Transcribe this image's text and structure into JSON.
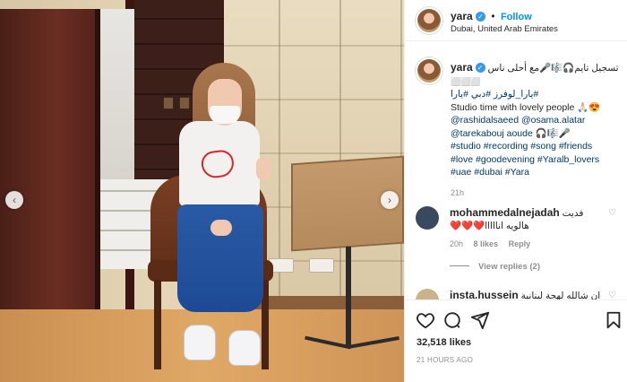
{
  "post": {
    "username": "yara",
    "follow_label": "Follow",
    "separator": "•",
    "location": "Dubai, United Arab Emirates",
    "verified_mark": "✓"
  },
  "caption": {
    "username": "yara",
    "line1": "تسجيل تايم🎧🎼🎤مع أحلى ناس",
    "line1_tail": "⬜⬜⬜",
    "line2": "#يارا_لوفرز #دبي #يارا",
    "line3": "Studio time with lovely people 🙏🏻😍",
    "mentions1": "@rashidalsaeed @osama.alatar",
    "mentions2": "@tarekabouj aoude 🎧🎼🎤",
    "hashtags1": "#studio #recording #song #friends",
    "hashtags2": "#love #goodevening #Yaralb_lovers",
    "hashtags3": "#uae #dubai #Yara",
    "time": "21h"
  },
  "comments": [
    {
      "username": "mohammedalnejadah",
      "text1": "فديت",
      "text2": "هالويه انااااا❤️❤️❤️",
      "time": "20h",
      "likes": "8 likes",
      "reply": "Reply"
    },
    {
      "username": "insta.hussein",
      "text1": "ان شالله لهجة لبنانية"
    }
  ],
  "view_replies": "View replies (2)",
  "actions": {
    "like_icon": "heart-outline-icon",
    "comment_icon": "comment-icon",
    "share_icon": "share-icon",
    "save_icon": "bookmark-icon"
  },
  "likes": "32,518 likes",
  "posted_time": "21 HOURS AGO",
  "carousel": {
    "prev": "‹",
    "next": "›"
  }
}
